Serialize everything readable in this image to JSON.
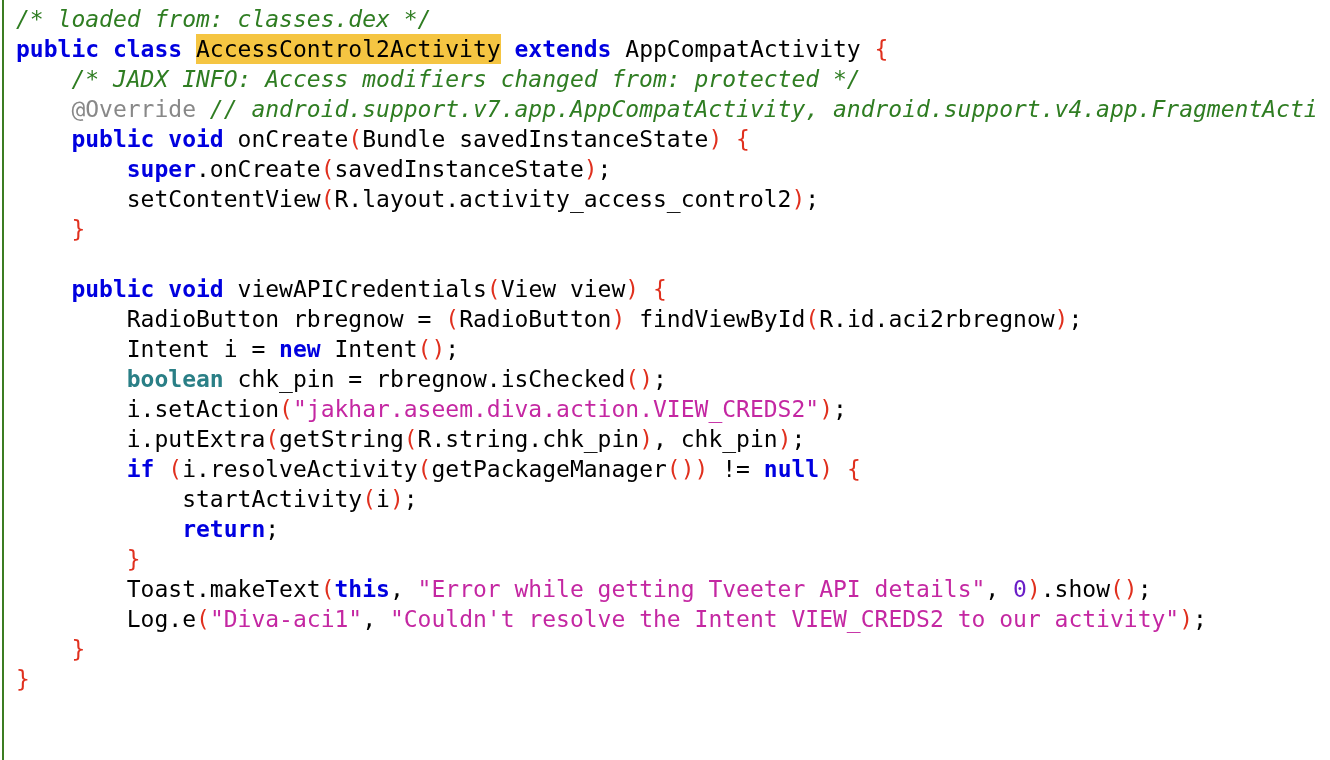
{
  "code_blocks": [
    {
      "lines": [
        {
          "tokens": [
            {
              "text": "/* loaded from: classes.dex */",
              "kind": "comment"
            }
          ]
        },
        {
          "tokens": [
            {
              "text": "public class ",
              "kind": "keyword"
            },
            {
              "text": "AccessControl2Activity",
              "kind": "highlight"
            },
            {
              "text": " extends",
              "kind": "keyword"
            },
            {
              "text": " AppCompatActivity ",
              "kind": "plain"
            },
            {
              "text": "{",
              "kind": "bracket"
            }
          ]
        },
        {
          "tokens": [
            {
              "text": "    /* JADX INFO: Access modifiers changed from: protected */",
              "kind": "comment"
            }
          ]
        },
        {
          "tokens": [
            {
              "text": "    @Override",
              "kind": "annotation"
            },
            {
              "text": " // android.support.v7.app.AppCompatActivity, android.support.v4.app.FragmentActi",
              "kind": "comment"
            }
          ]
        },
        {
          "tokens": [
            {
              "text": "    public void",
              "kind": "keyword"
            },
            {
              "text": " onCreate",
              "kind": "plain"
            },
            {
              "text": "(",
              "kind": "bracket"
            },
            {
              "text": "Bundle savedInstanceState",
              "kind": "plain"
            },
            {
              "text": ")",
              "kind": "bracket"
            },
            {
              "text": " {",
              "kind": "bracket"
            }
          ]
        },
        {
          "tokens": [
            {
              "text": "        super",
              "kind": "keyword"
            },
            {
              "text": ".onCreate",
              "kind": "plain"
            },
            {
              "text": "(",
              "kind": "bracket"
            },
            {
              "text": "savedInstanceState",
              "kind": "plain"
            },
            {
              "text": ")",
              "kind": "bracket"
            },
            {
              "text": ";",
              "kind": "plain"
            }
          ]
        },
        {
          "tokens": [
            {
              "text": "        setContentView",
              "kind": "plain"
            },
            {
              "text": "(",
              "kind": "bracket"
            },
            {
              "text": "R.layout.activity_access_control2",
              "kind": "plain"
            },
            {
              "text": ")",
              "kind": "bracket"
            },
            {
              "text": ";",
              "kind": "plain"
            }
          ]
        },
        {
          "tokens": [
            {
              "text": "    }",
              "kind": "bracket"
            }
          ]
        }
      ]
    },
    {
      "lines": [
        {
          "tokens": [
            {
              "text": "    public void",
              "kind": "keyword"
            },
            {
              "text": " viewAPICredentials",
              "kind": "plain"
            },
            {
              "text": "(",
              "kind": "bracket"
            },
            {
              "text": "View view",
              "kind": "plain"
            },
            {
              "text": ")",
              "kind": "bracket"
            },
            {
              "text": " {",
              "kind": "bracket"
            }
          ]
        },
        {
          "tokens": [
            {
              "text": "        RadioButton rbregnow = ",
              "kind": "plain"
            },
            {
              "text": "(",
              "kind": "bracket"
            },
            {
              "text": "RadioButton",
              "kind": "plain"
            },
            {
              "text": ")",
              "kind": "bracket"
            },
            {
              "text": " findViewById",
              "kind": "plain"
            },
            {
              "text": "(",
              "kind": "bracket"
            },
            {
              "text": "R.id.aci2rbregnow",
              "kind": "plain"
            },
            {
              "text": ")",
              "kind": "bracket"
            },
            {
              "text": ";",
              "kind": "plain"
            }
          ]
        },
        {
          "tokens": [
            {
              "text": "        Intent i = ",
              "kind": "plain"
            },
            {
              "text": "new",
              "kind": "keyword"
            },
            {
              "text": " Intent",
              "kind": "plain"
            },
            {
              "text": "()",
              "kind": "bracket"
            },
            {
              "text": ";",
              "kind": "plain"
            }
          ]
        },
        {
          "tokens": [
            {
              "text": "        boolean",
              "kind": "type"
            },
            {
              "text": " chk_pin = rbregnow.isChecked",
              "kind": "plain"
            },
            {
              "text": "()",
              "kind": "bracket"
            },
            {
              "text": ";",
              "kind": "plain"
            }
          ]
        },
        {
          "tokens": [
            {
              "text": "        i.setAction",
              "kind": "plain"
            },
            {
              "text": "(",
              "kind": "bracket"
            },
            {
              "text": "\"jakhar.aseem.diva.action.VIEW_CREDS2\"",
              "kind": "string"
            },
            {
              "text": ")",
              "kind": "bracket"
            },
            {
              "text": ";",
              "kind": "plain"
            }
          ]
        },
        {
          "tokens": [
            {
              "text": "        i.putExtra",
              "kind": "plain"
            },
            {
              "text": "(",
              "kind": "bracket"
            },
            {
              "text": "getString",
              "kind": "plain"
            },
            {
              "text": "(",
              "kind": "bracket"
            },
            {
              "text": "R.string.chk_pin",
              "kind": "plain"
            },
            {
              "text": ")",
              "kind": "bracket"
            },
            {
              "text": ", chk_pin",
              "kind": "plain"
            },
            {
              "text": ")",
              "kind": "bracket"
            },
            {
              "text": ";",
              "kind": "plain"
            }
          ]
        },
        {
          "tokens": [
            {
              "text": "        if",
              "kind": "keyword"
            },
            {
              "text": " (",
              "kind": "bracket"
            },
            {
              "text": "i.resolveActivity",
              "kind": "plain"
            },
            {
              "text": "(",
              "kind": "bracket"
            },
            {
              "text": "getPackageManager",
              "kind": "plain"
            },
            {
              "text": "())",
              "kind": "bracket"
            },
            {
              "text": " != ",
              "kind": "plain"
            },
            {
              "text": "null",
              "kind": "keyword"
            },
            {
              "text": ")",
              "kind": "bracket"
            },
            {
              "text": " {",
              "kind": "bracket"
            }
          ]
        },
        {
          "tokens": [
            {
              "text": "            startActivity",
              "kind": "plain"
            },
            {
              "text": "(",
              "kind": "bracket"
            },
            {
              "text": "i",
              "kind": "plain"
            },
            {
              "text": ")",
              "kind": "bracket"
            },
            {
              "text": ";",
              "kind": "plain"
            }
          ]
        },
        {
          "tokens": [
            {
              "text": "            return",
              "kind": "keyword"
            },
            {
              "text": ";",
              "kind": "plain"
            }
          ]
        },
        {
          "tokens": [
            {
              "text": "        }",
              "kind": "bracket"
            }
          ]
        },
        {
          "tokens": [
            {
              "text": "        Toast.makeText",
              "kind": "plain"
            },
            {
              "text": "(",
              "kind": "bracket"
            },
            {
              "text": "this",
              "kind": "keyword"
            },
            {
              "text": ", ",
              "kind": "plain"
            },
            {
              "text": "\"Error while getting Tveeter API details\"",
              "kind": "string"
            },
            {
              "text": ", ",
              "kind": "plain"
            },
            {
              "text": "0",
              "kind": "number"
            },
            {
              "text": ")",
              "kind": "bracket"
            },
            {
              "text": ".show",
              "kind": "plain"
            },
            {
              "text": "()",
              "kind": "bracket"
            },
            {
              "text": ";",
              "kind": "plain"
            }
          ]
        },
        {
          "tokens": [
            {
              "text": "        Log.e",
              "kind": "plain"
            },
            {
              "text": "(",
              "kind": "bracket"
            },
            {
              "text": "\"Diva-aci1\"",
              "kind": "string"
            },
            {
              "text": ", ",
              "kind": "plain"
            },
            {
              "text": "\"Couldn't resolve the Intent VIEW_CREDS2 to our activity\"",
              "kind": "string"
            },
            {
              "text": ")",
              "kind": "bracket"
            },
            {
              "text": ";",
              "kind": "plain"
            }
          ]
        },
        {
          "tokens": [
            {
              "text": "    }",
              "kind": "bracket"
            }
          ]
        },
        {
          "tokens": [
            {
              "text": "}",
              "kind": "bracket"
            }
          ]
        }
      ]
    }
  ]
}
